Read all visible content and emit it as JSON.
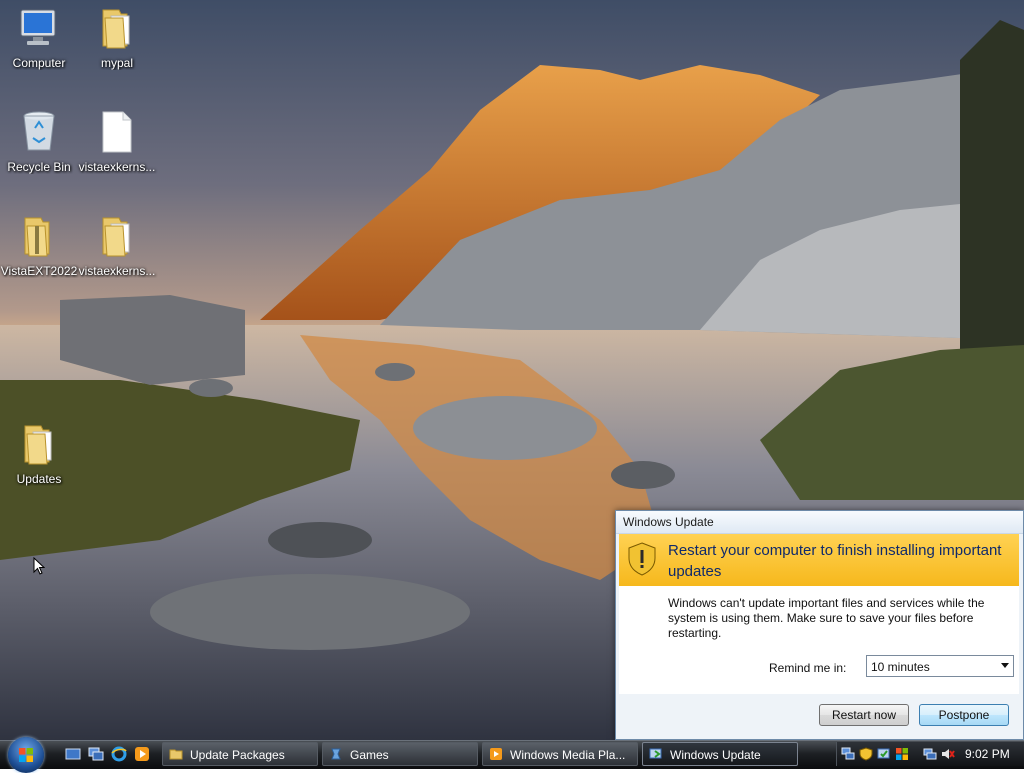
{
  "desktop": {
    "icons": [
      {
        "label": "Computer"
      },
      {
        "label": "mypal"
      },
      {
        "label": "Recycle Bin"
      },
      {
        "label": "vistaexkerns..."
      },
      {
        "label": "VistaEXT2022"
      },
      {
        "label": "vistaexkerns..."
      },
      {
        "label": "Updates"
      }
    ]
  },
  "windows_update": {
    "title": "Windows Update",
    "heading": "Restart your computer to finish installing important updates",
    "message": "Windows can't update important files and services while the system is using them. Make sure to save your files before restarting.",
    "remind_label": "Remind me in:",
    "remind_value": "10 minutes",
    "restart_button": "Restart now",
    "postpone_button": "Postpone"
  },
  "taskbar": {
    "buttons": [
      {
        "label": "Update Packages",
        "icon": "folder-icon"
      },
      {
        "label": "Games",
        "icon": "games-icon"
      },
      {
        "label": "Windows Media Pla...",
        "icon": "media-player-icon"
      },
      {
        "label": "Windows Update",
        "icon": "windows-update-icon"
      }
    ],
    "clock": "9:02 PM"
  }
}
